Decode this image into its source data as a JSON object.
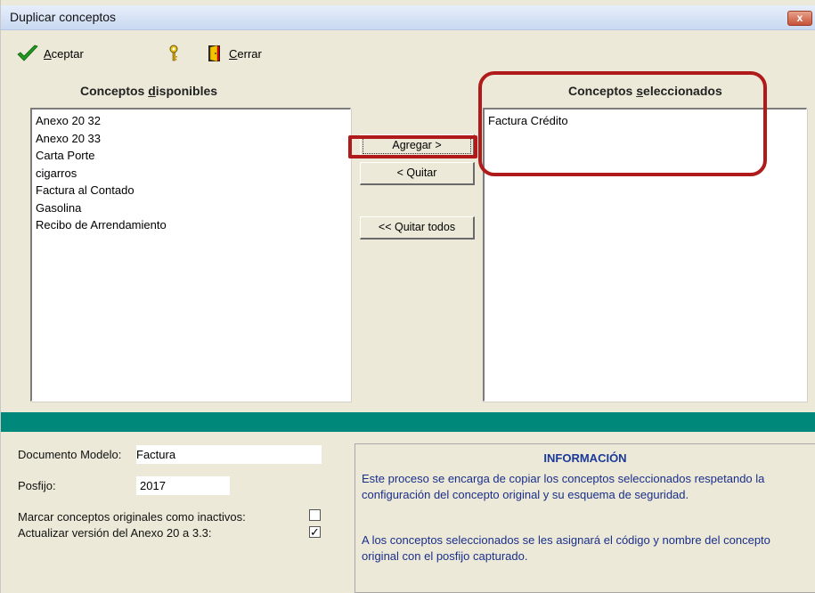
{
  "window": {
    "title": "Duplicar conceptos",
    "close_label": "x"
  },
  "toolbar": {
    "accept_label_u": "A",
    "accept_label_rest": "ceptar",
    "close_label_u": "C",
    "close_label_rest": "errar"
  },
  "available": {
    "label_pre": "Conceptos ",
    "label_u": "d",
    "label_post": "isponibles",
    "items": [
      "Anexo 20 32",
      "Anexo 20 33",
      "Carta Porte",
      "cigarros",
      "Factura al Contado",
      "Gasolina",
      "Recibo de Arrendamiento"
    ]
  },
  "selected": {
    "label_pre": "Conceptos ",
    "label_u": "s",
    "label_post": "eleccionados",
    "items": [
      "Factura Crédito"
    ]
  },
  "actions": {
    "add": "Agregar >",
    "remove": "< Quitar",
    "remove_all": "<< Quitar todos"
  },
  "form": {
    "model_label": "Documento Modelo:",
    "model_value": "Factura",
    "suffix_label": "Posfijo:",
    "suffix_value": "2017",
    "mark_inactive_label": "Marcar conceptos originales como inactivos:",
    "mark_inactive_checked": false,
    "update_version_label": "Actualizar versión del Anexo 20 a 3.3:",
    "update_version_checked": true
  },
  "info": {
    "title": "INFORMACIÓN",
    "p1": "Este proceso se encarga de copiar los conceptos seleccionados respetando la configuración del concepto original y su esquema de seguridad.",
    "p2": "A los conceptos seleccionados se les asignará el código y nombre del concepto original con el posfijo capturado."
  },
  "colors": {
    "highlight": "#b01a1a",
    "teal_band": "#00897b",
    "info_text": "#1a2f8a"
  }
}
